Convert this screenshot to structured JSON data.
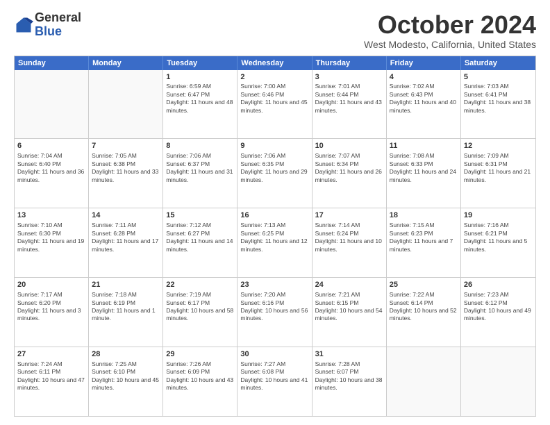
{
  "logo": {
    "general": "General",
    "blue": "Blue"
  },
  "title": "October 2024",
  "subtitle": "West Modesto, California, United States",
  "header_days": [
    "Sunday",
    "Monday",
    "Tuesday",
    "Wednesday",
    "Thursday",
    "Friday",
    "Saturday"
  ],
  "weeks": [
    [
      {
        "day": "",
        "text": ""
      },
      {
        "day": "",
        "text": ""
      },
      {
        "day": "1",
        "text": "Sunrise: 6:59 AM\nSunset: 6:47 PM\nDaylight: 11 hours and 48 minutes."
      },
      {
        "day": "2",
        "text": "Sunrise: 7:00 AM\nSunset: 6:46 PM\nDaylight: 11 hours and 45 minutes."
      },
      {
        "day": "3",
        "text": "Sunrise: 7:01 AM\nSunset: 6:44 PM\nDaylight: 11 hours and 43 minutes."
      },
      {
        "day": "4",
        "text": "Sunrise: 7:02 AM\nSunset: 6:43 PM\nDaylight: 11 hours and 40 minutes."
      },
      {
        "day": "5",
        "text": "Sunrise: 7:03 AM\nSunset: 6:41 PM\nDaylight: 11 hours and 38 minutes."
      }
    ],
    [
      {
        "day": "6",
        "text": "Sunrise: 7:04 AM\nSunset: 6:40 PM\nDaylight: 11 hours and 36 minutes."
      },
      {
        "day": "7",
        "text": "Sunrise: 7:05 AM\nSunset: 6:38 PM\nDaylight: 11 hours and 33 minutes."
      },
      {
        "day": "8",
        "text": "Sunrise: 7:06 AM\nSunset: 6:37 PM\nDaylight: 11 hours and 31 minutes."
      },
      {
        "day": "9",
        "text": "Sunrise: 7:06 AM\nSunset: 6:35 PM\nDaylight: 11 hours and 29 minutes."
      },
      {
        "day": "10",
        "text": "Sunrise: 7:07 AM\nSunset: 6:34 PM\nDaylight: 11 hours and 26 minutes."
      },
      {
        "day": "11",
        "text": "Sunrise: 7:08 AM\nSunset: 6:33 PM\nDaylight: 11 hours and 24 minutes."
      },
      {
        "day": "12",
        "text": "Sunrise: 7:09 AM\nSunset: 6:31 PM\nDaylight: 11 hours and 21 minutes."
      }
    ],
    [
      {
        "day": "13",
        "text": "Sunrise: 7:10 AM\nSunset: 6:30 PM\nDaylight: 11 hours and 19 minutes."
      },
      {
        "day": "14",
        "text": "Sunrise: 7:11 AM\nSunset: 6:28 PM\nDaylight: 11 hours and 17 minutes."
      },
      {
        "day": "15",
        "text": "Sunrise: 7:12 AM\nSunset: 6:27 PM\nDaylight: 11 hours and 14 minutes."
      },
      {
        "day": "16",
        "text": "Sunrise: 7:13 AM\nSunset: 6:25 PM\nDaylight: 11 hours and 12 minutes."
      },
      {
        "day": "17",
        "text": "Sunrise: 7:14 AM\nSunset: 6:24 PM\nDaylight: 11 hours and 10 minutes."
      },
      {
        "day": "18",
        "text": "Sunrise: 7:15 AM\nSunset: 6:23 PM\nDaylight: 11 hours and 7 minutes."
      },
      {
        "day": "19",
        "text": "Sunrise: 7:16 AM\nSunset: 6:21 PM\nDaylight: 11 hours and 5 minutes."
      }
    ],
    [
      {
        "day": "20",
        "text": "Sunrise: 7:17 AM\nSunset: 6:20 PM\nDaylight: 11 hours and 3 minutes."
      },
      {
        "day": "21",
        "text": "Sunrise: 7:18 AM\nSunset: 6:19 PM\nDaylight: 11 hours and 1 minute."
      },
      {
        "day": "22",
        "text": "Sunrise: 7:19 AM\nSunset: 6:17 PM\nDaylight: 10 hours and 58 minutes."
      },
      {
        "day": "23",
        "text": "Sunrise: 7:20 AM\nSunset: 6:16 PM\nDaylight: 10 hours and 56 minutes."
      },
      {
        "day": "24",
        "text": "Sunrise: 7:21 AM\nSunset: 6:15 PM\nDaylight: 10 hours and 54 minutes."
      },
      {
        "day": "25",
        "text": "Sunrise: 7:22 AM\nSunset: 6:14 PM\nDaylight: 10 hours and 52 minutes."
      },
      {
        "day": "26",
        "text": "Sunrise: 7:23 AM\nSunset: 6:12 PM\nDaylight: 10 hours and 49 minutes."
      }
    ],
    [
      {
        "day": "27",
        "text": "Sunrise: 7:24 AM\nSunset: 6:11 PM\nDaylight: 10 hours and 47 minutes."
      },
      {
        "day": "28",
        "text": "Sunrise: 7:25 AM\nSunset: 6:10 PM\nDaylight: 10 hours and 45 minutes."
      },
      {
        "day": "29",
        "text": "Sunrise: 7:26 AM\nSunset: 6:09 PM\nDaylight: 10 hours and 43 minutes."
      },
      {
        "day": "30",
        "text": "Sunrise: 7:27 AM\nSunset: 6:08 PM\nDaylight: 10 hours and 41 minutes."
      },
      {
        "day": "31",
        "text": "Sunrise: 7:28 AM\nSunset: 6:07 PM\nDaylight: 10 hours and 38 minutes."
      },
      {
        "day": "",
        "text": ""
      },
      {
        "day": "",
        "text": ""
      }
    ]
  ]
}
